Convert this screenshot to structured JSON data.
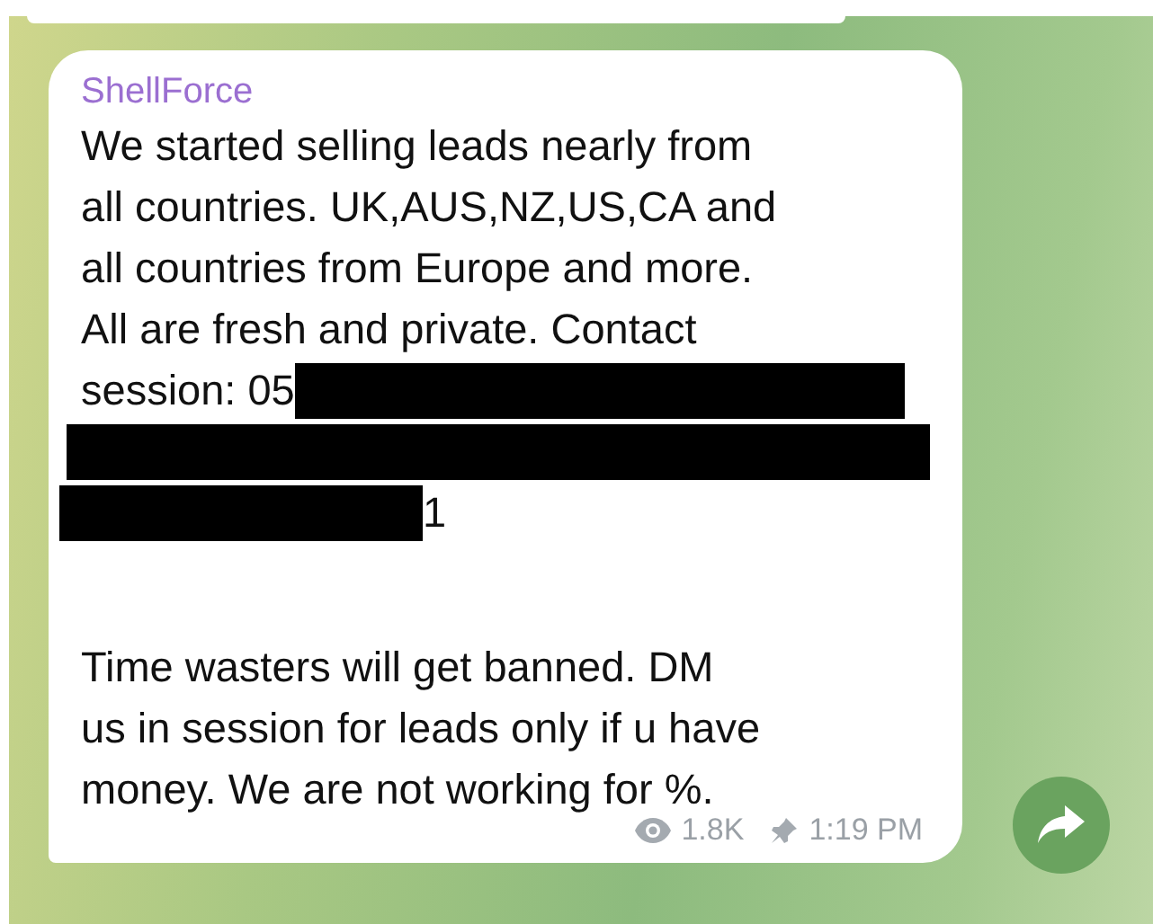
{
  "message": {
    "sender": "ShellForce",
    "body": [
      {
        "kind": "text",
        "text": "We started selling leads nearly from\nall countries. UK,AUS,NZ,US,CA and\nall countries from Europe and more.\nAll are fresh and private. Contact"
      },
      {
        "kind": "redacted",
        "before": "session: 05"
      },
      {
        "kind": "redacted"
      },
      {
        "kind": "redacted",
        "after": "1"
      },
      {
        "kind": "blank"
      },
      {
        "kind": "text",
        "text": "Time wasters will get banned. DM\nus in session for leads only if u have\nmoney. We are not working for %."
      }
    ],
    "views": "1.8K",
    "time": "1:19 PM"
  }
}
